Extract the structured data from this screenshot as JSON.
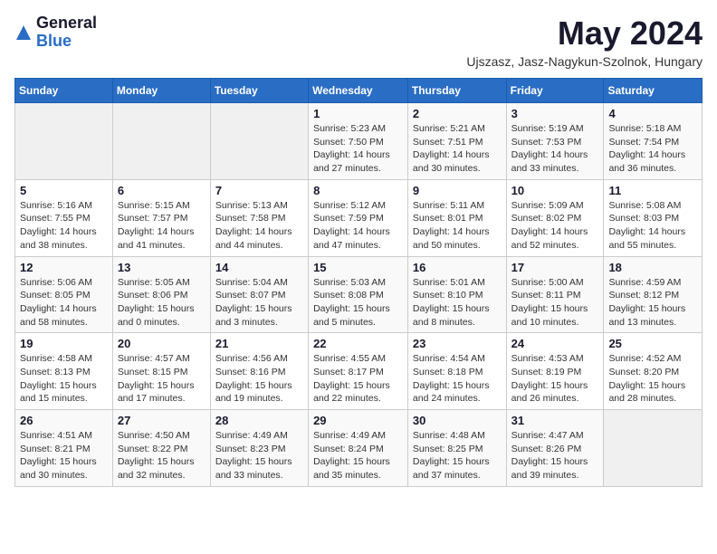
{
  "logo": {
    "general": "General",
    "blue": "Blue"
  },
  "title": "May 2024",
  "subtitle": "Ujszasz, Jasz-Nagykun-Szolnok, Hungary",
  "days_of_week": [
    "Sunday",
    "Monday",
    "Tuesday",
    "Wednesday",
    "Thursday",
    "Friday",
    "Saturday"
  ],
  "weeks": [
    [
      {
        "day": "",
        "info": ""
      },
      {
        "day": "",
        "info": ""
      },
      {
        "day": "",
        "info": ""
      },
      {
        "day": "1",
        "info": "Sunrise: 5:23 AM\nSunset: 7:50 PM\nDaylight: 14 hours\nand 27 minutes."
      },
      {
        "day": "2",
        "info": "Sunrise: 5:21 AM\nSunset: 7:51 PM\nDaylight: 14 hours\nand 30 minutes."
      },
      {
        "day": "3",
        "info": "Sunrise: 5:19 AM\nSunset: 7:53 PM\nDaylight: 14 hours\nand 33 minutes."
      },
      {
        "day": "4",
        "info": "Sunrise: 5:18 AM\nSunset: 7:54 PM\nDaylight: 14 hours\nand 36 minutes."
      }
    ],
    [
      {
        "day": "5",
        "info": "Sunrise: 5:16 AM\nSunset: 7:55 PM\nDaylight: 14 hours\nand 38 minutes."
      },
      {
        "day": "6",
        "info": "Sunrise: 5:15 AM\nSunset: 7:57 PM\nDaylight: 14 hours\nand 41 minutes."
      },
      {
        "day": "7",
        "info": "Sunrise: 5:13 AM\nSunset: 7:58 PM\nDaylight: 14 hours\nand 44 minutes."
      },
      {
        "day": "8",
        "info": "Sunrise: 5:12 AM\nSunset: 7:59 PM\nDaylight: 14 hours\nand 47 minutes."
      },
      {
        "day": "9",
        "info": "Sunrise: 5:11 AM\nSunset: 8:01 PM\nDaylight: 14 hours\nand 50 minutes."
      },
      {
        "day": "10",
        "info": "Sunrise: 5:09 AM\nSunset: 8:02 PM\nDaylight: 14 hours\nand 52 minutes."
      },
      {
        "day": "11",
        "info": "Sunrise: 5:08 AM\nSunset: 8:03 PM\nDaylight: 14 hours\nand 55 minutes."
      }
    ],
    [
      {
        "day": "12",
        "info": "Sunrise: 5:06 AM\nSunset: 8:05 PM\nDaylight: 14 hours\nand 58 minutes."
      },
      {
        "day": "13",
        "info": "Sunrise: 5:05 AM\nSunset: 8:06 PM\nDaylight: 15 hours\nand 0 minutes."
      },
      {
        "day": "14",
        "info": "Sunrise: 5:04 AM\nSunset: 8:07 PM\nDaylight: 15 hours\nand 3 minutes."
      },
      {
        "day": "15",
        "info": "Sunrise: 5:03 AM\nSunset: 8:08 PM\nDaylight: 15 hours\nand 5 minutes."
      },
      {
        "day": "16",
        "info": "Sunrise: 5:01 AM\nSunset: 8:10 PM\nDaylight: 15 hours\nand 8 minutes."
      },
      {
        "day": "17",
        "info": "Sunrise: 5:00 AM\nSunset: 8:11 PM\nDaylight: 15 hours\nand 10 minutes."
      },
      {
        "day": "18",
        "info": "Sunrise: 4:59 AM\nSunset: 8:12 PM\nDaylight: 15 hours\nand 13 minutes."
      }
    ],
    [
      {
        "day": "19",
        "info": "Sunrise: 4:58 AM\nSunset: 8:13 PM\nDaylight: 15 hours\nand 15 minutes."
      },
      {
        "day": "20",
        "info": "Sunrise: 4:57 AM\nSunset: 8:15 PM\nDaylight: 15 hours\nand 17 minutes."
      },
      {
        "day": "21",
        "info": "Sunrise: 4:56 AM\nSunset: 8:16 PM\nDaylight: 15 hours\nand 19 minutes."
      },
      {
        "day": "22",
        "info": "Sunrise: 4:55 AM\nSunset: 8:17 PM\nDaylight: 15 hours\nand 22 minutes."
      },
      {
        "day": "23",
        "info": "Sunrise: 4:54 AM\nSunset: 8:18 PM\nDaylight: 15 hours\nand 24 minutes."
      },
      {
        "day": "24",
        "info": "Sunrise: 4:53 AM\nSunset: 8:19 PM\nDaylight: 15 hours\nand 26 minutes."
      },
      {
        "day": "25",
        "info": "Sunrise: 4:52 AM\nSunset: 8:20 PM\nDaylight: 15 hours\nand 28 minutes."
      }
    ],
    [
      {
        "day": "26",
        "info": "Sunrise: 4:51 AM\nSunset: 8:21 PM\nDaylight: 15 hours\nand 30 minutes."
      },
      {
        "day": "27",
        "info": "Sunrise: 4:50 AM\nSunset: 8:22 PM\nDaylight: 15 hours\nand 32 minutes."
      },
      {
        "day": "28",
        "info": "Sunrise: 4:49 AM\nSunset: 8:23 PM\nDaylight: 15 hours\nand 33 minutes."
      },
      {
        "day": "29",
        "info": "Sunrise: 4:49 AM\nSunset: 8:24 PM\nDaylight: 15 hours\nand 35 minutes."
      },
      {
        "day": "30",
        "info": "Sunrise: 4:48 AM\nSunset: 8:25 PM\nDaylight: 15 hours\nand 37 minutes."
      },
      {
        "day": "31",
        "info": "Sunrise: 4:47 AM\nSunset: 8:26 PM\nDaylight: 15 hours\nand 39 minutes."
      },
      {
        "day": "",
        "info": ""
      }
    ]
  ]
}
